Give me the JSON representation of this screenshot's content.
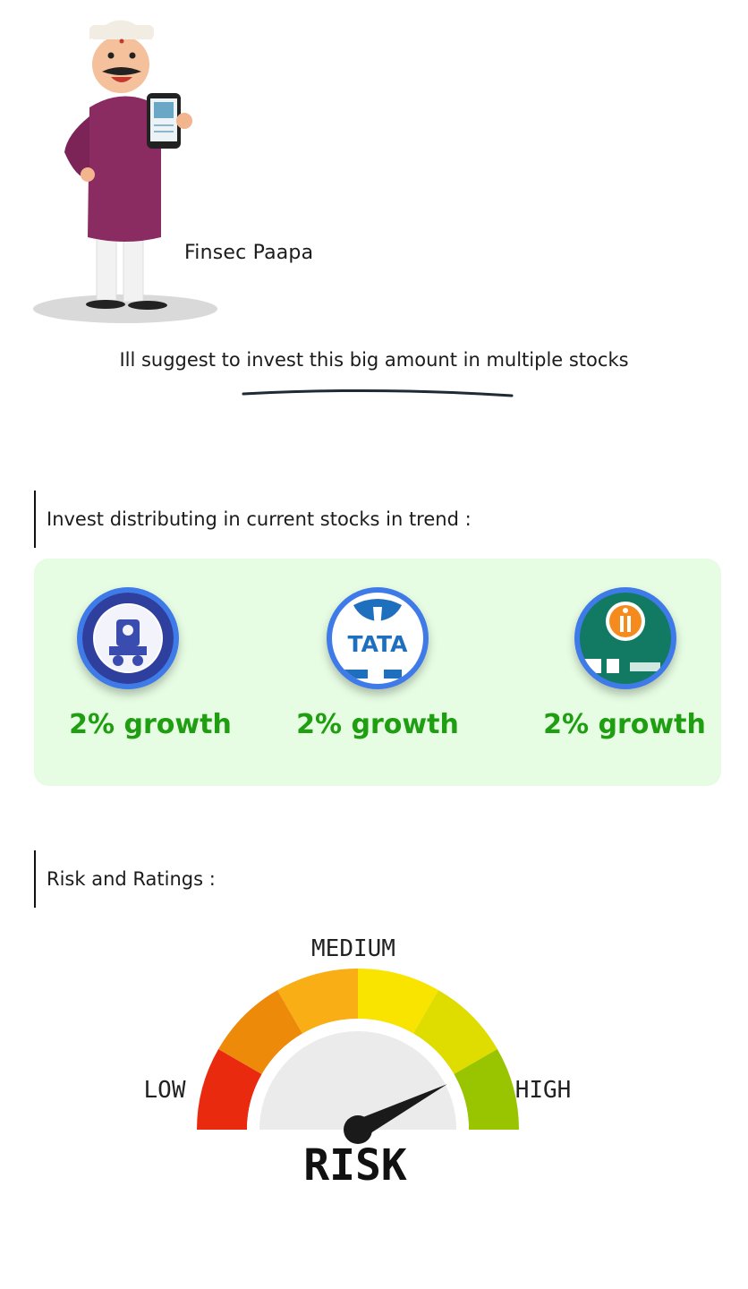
{
  "mascot": {
    "name": "Finsec Paapa",
    "icon": "mascot-man-with-phone-illustration"
  },
  "suggestion": {
    "text": "Ill suggest to invest this big amount in multiple stocks"
  },
  "stocks_section": {
    "title": "Invest distributing in current stocks in trend :",
    "items": [
      {
        "logo": "indian-railways-logo",
        "growth": "2% growth"
      },
      {
        "logo": "tata-power-logo",
        "growth": "2% growth"
      },
      {
        "logo": "idbi-bank-logo",
        "growth": "2% growth"
      }
    ],
    "colors": {
      "panel_bg": "#e6fde3",
      "growth_text": "#1f9e12",
      "logo_ring": "#3f7be8"
    }
  },
  "risk_section": {
    "title": "Risk and Ratings :",
    "gauge": {
      "label_low": "LOW",
      "label_medium": "MEDIUM",
      "label_high": "HIGH",
      "label_risk": "RISK",
      "needle_level": 0.85
    }
  }
}
